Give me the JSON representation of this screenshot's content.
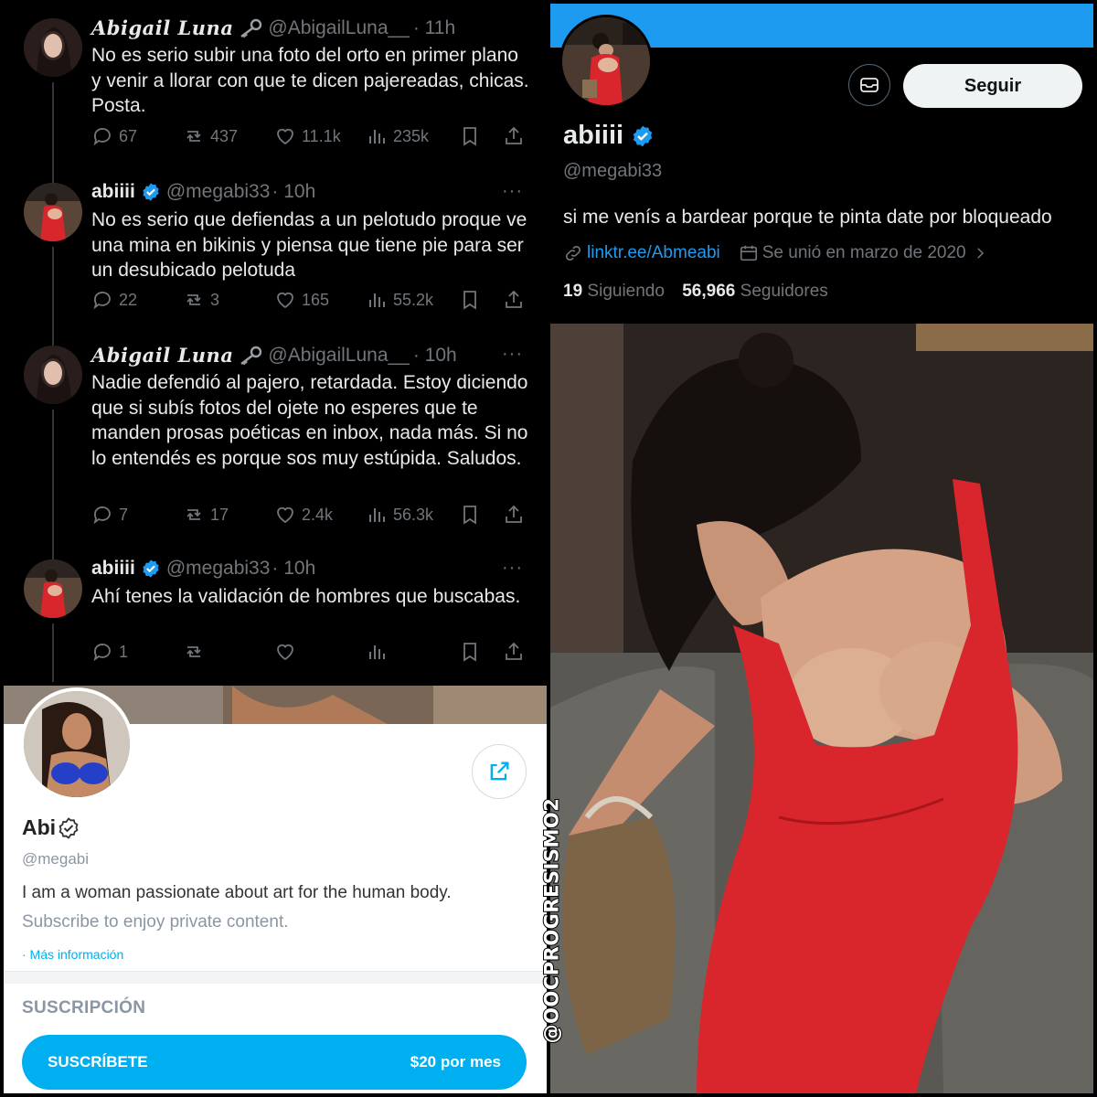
{
  "thread": {
    "tweets": [
      {
        "name": "Abigail Luna",
        "handle": "@AbigailLuna__",
        "time": "· 11h",
        "text": "No es serio subir una foto del orto en primer plano y venir a llorar con que te dicen pajereadas, chicas. Posta.",
        "replies": "67",
        "retweets": "437",
        "likes": "11.1k",
        "views": "235k"
      },
      {
        "name": "abiiii",
        "handle": "@megabi33",
        "time": "· 10h",
        "more": "···",
        "text": "No es serio que defiendas a un pelotudo proque ve una mina en bikinis y piensa que tiene pie para ser un desubicado pelotuda",
        "replies": "22",
        "retweets": "3",
        "likes": "165",
        "views": "55.2k"
      },
      {
        "name": "Abigail Luna",
        "handle": "@AbigailLuna__",
        "time": "· 10h",
        "more": "···",
        "text": "Nadie defendió al pajero, retardada. Estoy diciendo que si subís fotos del ojete no esperes que te manden prosas poéticas en inbox, nada más. Si no lo entendés es porque sos muy estúpida. Saludos.",
        "replies": "7",
        "retweets": "17",
        "likes": "2.4k",
        "views": "56.3k"
      },
      {
        "name": "abiiii",
        "handle": "@megabi33",
        "time": "· 10h",
        "more": "···",
        "text": "Ahí tenes la validación de hombres que buscabas.",
        "replies": "1",
        "retweets": "",
        "likes": "",
        "views": ""
      }
    ]
  },
  "profile": {
    "name": "abiiii",
    "handle": "@megabi33",
    "follow_label": "Seguir",
    "bio": "si me venís a bardear porque te pinta date por bloqueado",
    "link": "linktr.ee/Abmeabi",
    "joined": "Se unió en marzo de 2020",
    "following_count": "19",
    "following_label": "Siguiendo",
    "followers_count": "56,966",
    "followers_label": "Seguidores"
  },
  "card": {
    "name": "Abi",
    "handle": "@megabi",
    "bio_line1": "I am a woman passionate about art for the human body.",
    "bio_line2": "Subscribe to enjoy private content.",
    "more_info": "· Más información",
    "section_title": "SUSCRIPCIÓN",
    "subscribe_label": "SUSCRÍBETE",
    "price": "$20 por mes"
  },
  "watermark": "@OOCPROGRESISMO2",
  "colors": {
    "twitter_blue": "#1d9bf0",
    "onlyfans_blue": "#00aff0",
    "dress_red": "#d8262c",
    "muted_gray": "#71767b"
  }
}
